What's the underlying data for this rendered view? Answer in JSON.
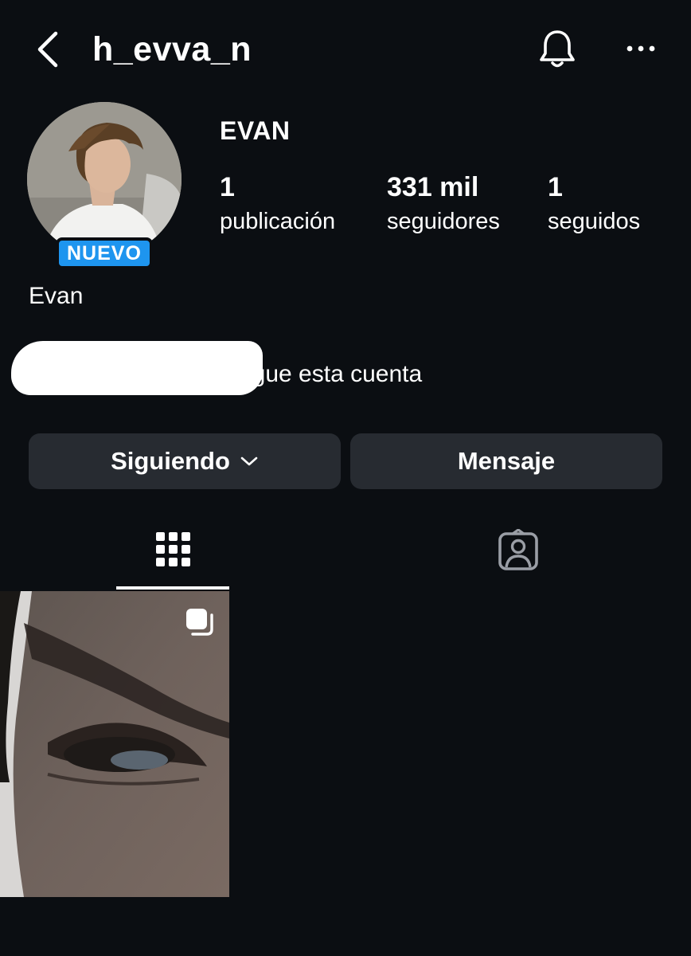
{
  "header": {
    "username": "h_evva_n",
    "icons": [
      "back-chevron-icon",
      "bell-icon",
      "more-options-icon"
    ]
  },
  "profile": {
    "badge": "NUEVO",
    "display_name": "EVAN",
    "stats": {
      "posts": {
        "value": "1",
        "label": "publicación"
      },
      "followers": {
        "value": "331 mil",
        "label": "seguidores"
      },
      "following": {
        "value": "1",
        "label": "seguidos"
      }
    },
    "bio_name": "Evan",
    "followed_by_text": "igue esta cuenta"
  },
  "actions": {
    "following_label": "Siguiendo",
    "message_label": "Mensaje"
  },
  "tabs": [
    {
      "name": "posts-grid",
      "icon": "grid-icon",
      "active": true
    },
    {
      "name": "tagged",
      "icon": "tagged-person-icon",
      "active": false
    }
  ],
  "colors": {
    "background": "#0b0e12",
    "button": "#272b31",
    "badge": "#1e95ef",
    "text": "#ffffff"
  }
}
